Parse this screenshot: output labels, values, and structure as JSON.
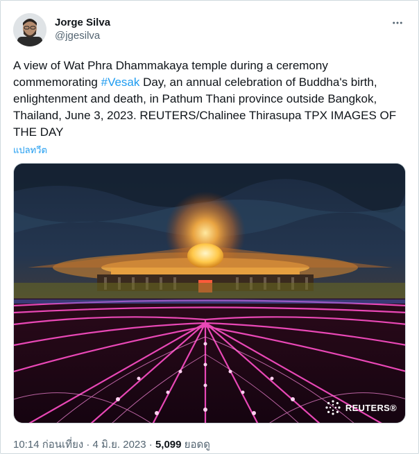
{
  "author": {
    "display_name": "Jorge Silva",
    "handle": "@jgesilva",
    "avatar_icon": "profile-photo"
  },
  "more_icon": "more-horizontal-icon",
  "tweet": {
    "text_before": "A view of Wat Phra Dhammakaya temple during a ceremony commemorating ",
    "hashtag": "#Vesak",
    "text_after": " Day, an annual celebration of Buddha's birth, enlightenment and death, in Pathum Thani province outside Bangkok, Thailand, June 3, 2023. REUTERS/Chalinee Thirasupa     TPX IMAGES OF THE DAY"
  },
  "translate_label": "แปลทวีต",
  "media": {
    "watermark": "REUTERS®"
  },
  "meta": {
    "time": "10:14 ก่อนเที่ยง",
    "separator": " · ",
    "date": "4 มิ.ย. 2023",
    "views_count": "5,099",
    "views_label": "ยอดดู"
  },
  "colors": {
    "link": "#1d9bf0",
    "secondary_text": "#536471",
    "border": "#cfd9de"
  }
}
